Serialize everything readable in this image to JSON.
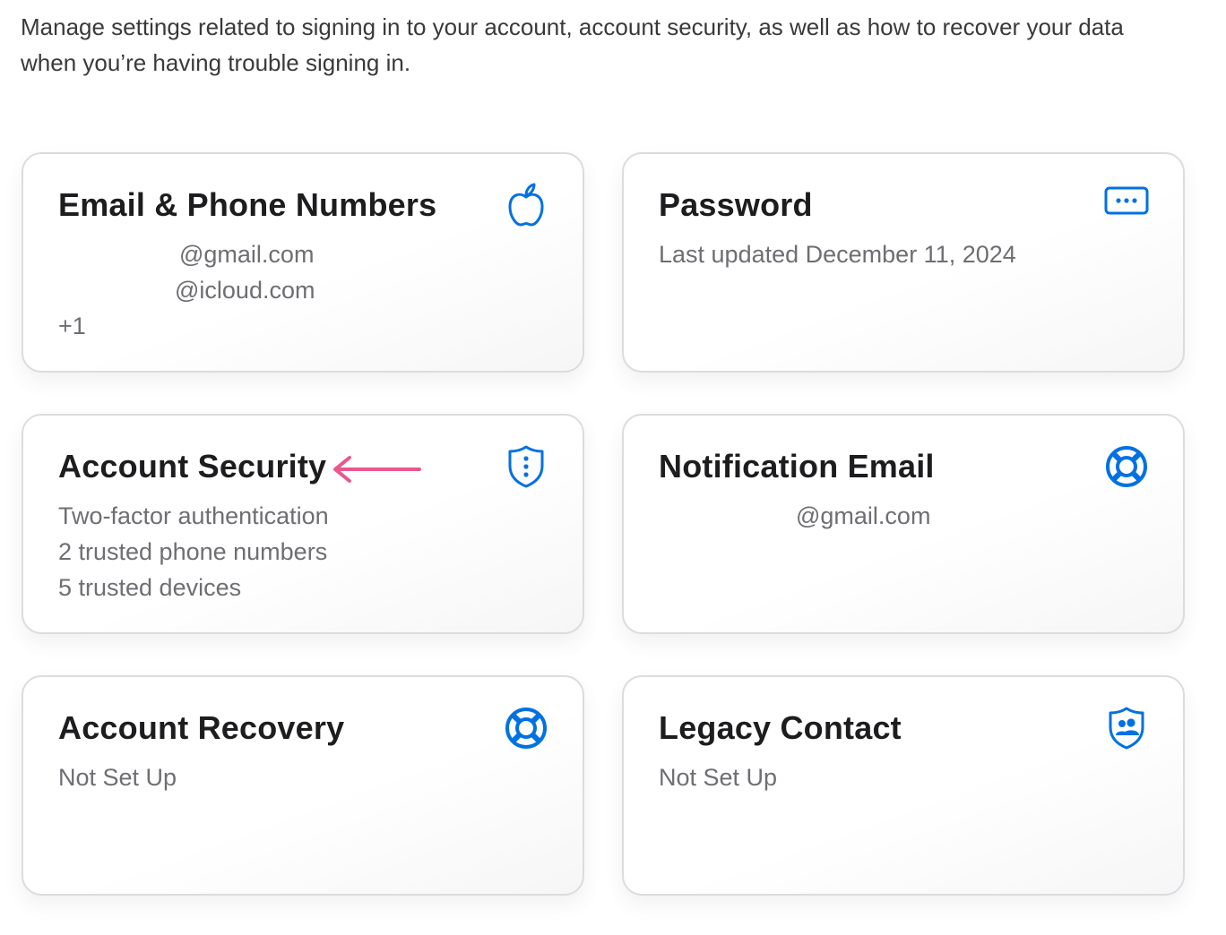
{
  "intro": {
    "text": "Manage settings related to signing in to your account, account security, as well as how to recover your data when you’re having trouble signing in."
  },
  "colors": {
    "accent": "#0071e3",
    "annotation_arrow": "#e8588f",
    "card_border": "#dcdcde",
    "secondary_text": "#6e6e73"
  },
  "cards": {
    "email_phone": {
      "title": "Email & Phone Numbers",
      "icon": "apple-icon",
      "lines": [
        "@gmail.com",
        "@icloud.com",
        "+1"
      ]
    },
    "password": {
      "title": "Password",
      "icon": "password-dots-icon",
      "lines": [
        "Last updated December 11, 2024"
      ]
    },
    "account_security": {
      "title": "Account Security",
      "icon": "shield-dots-icon",
      "lines": [
        "Two-factor authentication",
        "2 trusted phone numbers",
        "5 trusted devices"
      ]
    },
    "notification_email": {
      "title": "Notification Email",
      "icon": "lifebuoy-icon",
      "lines": [
        "@gmail.com"
      ]
    },
    "account_recovery": {
      "title": "Account Recovery",
      "icon": "lifebuoy-icon",
      "lines": [
        "Not Set Up"
      ]
    },
    "legacy_contact": {
      "title": "Legacy Contact",
      "icon": "shield-people-icon",
      "lines": [
        "Not Set Up"
      ]
    }
  }
}
